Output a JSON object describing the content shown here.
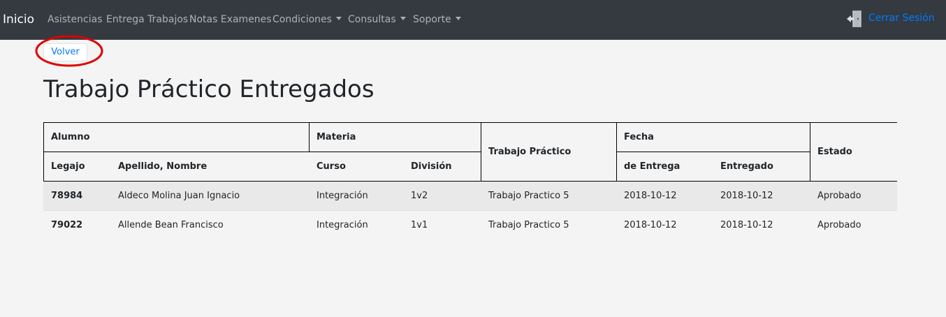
{
  "navbar": {
    "brand": "Inicio",
    "items": [
      {
        "label": "Asistencias"
      },
      {
        "label": "Entrega Trabajos"
      },
      {
        "label": "Notas Examenes"
      },
      {
        "label": "Condiciones"
      },
      {
        "label": "Consultas"
      },
      {
        "label": "Soporte"
      }
    ],
    "logout_label": "Cerrar Sesión",
    "logout_icon": "logout-door-icon"
  },
  "actions": {
    "back_label": "Volver"
  },
  "page": {
    "title": "Trabajo Práctico Entregados"
  },
  "table": {
    "group_headers": {
      "alumno": "Alumno",
      "materia": "Materia",
      "trabajo": "Trabajo Práctico",
      "fecha": "Fecha",
      "estado": "Estado"
    },
    "sub_headers": {
      "legajo": "Legajo",
      "nombre": "Apellido, Nombre",
      "curso": "Curso",
      "division": "División",
      "entrega": "de Entrega",
      "entregado": "Entregado"
    },
    "rows": [
      {
        "legajo": "78984",
        "nombre": "Aldeco Molina Juan Ignacio",
        "curso": "Integración",
        "division": "1v2",
        "trabajo": "Trabajo Practico 5",
        "entrega": "2018-10-12",
        "entregado": "2018-10-12",
        "estado": "Aprobado"
      },
      {
        "legajo": "79022",
        "nombre": "Allende Bean Francisco",
        "curso": "Integración",
        "division": "1v1",
        "trabajo": "Trabajo Practico 5",
        "entrega": "2018-10-12",
        "entregado": "2018-10-12",
        "estado": "Aprobado"
      }
    ]
  },
  "colors": {
    "navbar": "#343a40",
    "link": "#007bff",
    "highlight": "#e00000"
  }
}
